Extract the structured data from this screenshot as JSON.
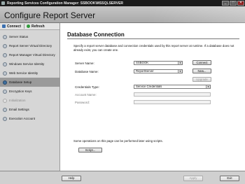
{
  "window": {
    "title": "Reporting Services Configuration Manager: SSBOOK\\MSSQLSERVER",
    "controls": {
      "minimize": "_",
      "maximize": "□",
      "close": "✕"
    }
  },
  "banner": {
    "title": "Configure Report Server"
  },
  "sidebar": {
    "toolbar": {
      "connect": "Connect",
      "refresh": "Refresh"
    },
    "items": [
      {
        "label": "Server Status",
        "state": "normal"
      },
      {
        "label": "Report Server Virtual Directory",
        "state": "normal"
      },
      {
        "label": "Report Manager Virtual Directory",
        "state": "normal"
      },
      {
        "label": "Windows Service Identity",
        "state": "normal"
      },
      {
        "label": "Web Service Identity",
        "state": "normal"
      },
      {
        "label": "Database Setup",
        "state": "selected"
      },
      {
        "label": "Encryption Keys",
        "state": "normal"
      },
      {
        "label": "Initialization",
        "state": "disabled"
      },
      {
        "label": "Email Settings",
        "state": "normal"
      },
      {
        "label": "Execution Account",
        "state": "normal"
      }
    ]
  },
  "main": {
    "heading": "Database Connection",
    "intro": "Specify a report server database and connection credentials used by this report server at runtime. If a database does not already exist, you can create one.",
    "server_name": {
      "label": "Server Name:",
      "value": "SSBOOK"
    },
    "database_name": {
      "label": "Database Name:",
      "value": "ReportServer"
    },
    "credentials_type": {
      "label": "Credentials Type:",
      "value": "Service Credentials"
    },
    "account_name": {
      "label": "Account Name:",
      "value": ""
    },
    "password": {
      "label": "Password:",
      "value": ""
    },
    "buttons": {
      "connect": "Connect",
      "new": "New...",
      "upgrade": "Upgrade"
    },
    "note": "Some operations on this page can be performed later using scripts.",
    "script_button": "Script..."
  },
  "footer": {
    "help": "Help",
    "apply": "Apply",
    "exit": "Exit"
  }
}
